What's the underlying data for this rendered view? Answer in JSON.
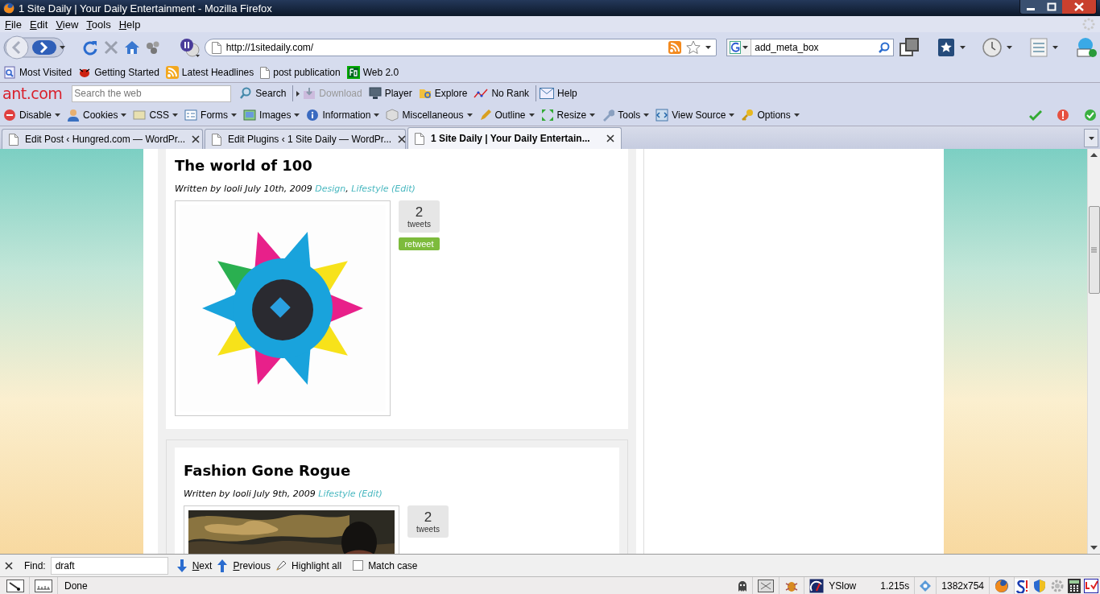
{
  "window": {
    "title": "1 Site Daily | Your Daily Entertainment - Mozilla Firefox"
  },
  "menu": [
    "File",
    "Edit",
    "View",
    "Tools",
    "Help"
  ],
  "address_bar": {
    "value": "http://1sitedaily.com/"
  },
  "search_box": {
    "value": "add_meta_box"
  },
  "bookmarks": [
    {
      "label": "Most Visited",
      "kind": "search"
    },
    {
      "label": "Getting Started",
      "kind": "bug"
    },
    {
      "label": "Latest Headlines",
      "kind": "feed"
    },
    {
      "label": "post publication",
      "kind": "page"
    },
    {
      "label": "Web 2.0",
      "kind": "badge"
    }
  ],
  "ant_toolbar": {
    "logo": "ant.com",
    "search_placeholder": "Search the web",
    "items": [
      {
        "label": "Search",
        "kind": "search",
        "disabled": false
      },
      {
        "label": "Download",
        "kind": "download",
        "disabled": true
      },
      {
        "label": "Player",
        "kind": "player",
        "disabled": false
      },
      {
        "label": "Explore",
        "kind": "explore",
        "disabled": false
      },
      {
        "label": "No Rank",
        "kind": "rank",
        "disabled": false
      },
      {
        "label": "Help",
        "kind": "help",
        "disabled": false
      }
    ]
  },
  "webdev_toolbar": [
    "Disable",
    "Cookies",
    "CSS",
    "Forms",
    "Images",
    "Information",
    "Miscellaneous",
    "Outline",
    "Resize",
    "Tools",
    "View Source",
    "Options"
  ],
  "tabs": [
    {
      "label": "Edit Post ‹ Hungred.com — WordPr...",
      "selected": false
    },
    {
      "label": "Edit Plugins ‹ 1 Site Daily — WordPr...",
      "selected": false
    },
    {
      "label": "1 Site Daily | Your Daily Entertain...",
      "selected": true
    }
  ],
  "posts": [
    {
      "title": "The world of 100",
      "byline": "Written by looli July 10th, 2009",
      "categories": [
        "Design",
        "Lifestyle"
      ],
      "separator": ",",
      "edit": "(Edit)",
      "tweet_count": "2",
      "tweet_label": "tweets",
      "retweet": "retweet",
      "image": {
        "kind": "picture"
      }
    },
    {
      "title": "Fashion Gone Rogue",
      "byline": "Written by looli July 9th, 2009",
      "categories": [
        "Lifestyle"
      ],
      "edit": "(Edit)",
      "tweet_count": "2",
      "tweet_label": "tweets",
      "image": {
        "kind": "picture"
      }
    }
  ],
  "find_bar": {
    "label": "Find:",
    "value": "draft",
    "next": "Next",
    "previous": "Previous",
    "highlight_all": "Highlight all",
    "match_case": {
      "label": "Match case",
      "checked": false
    }
  },
  "status_bar": {
    "status": "Done",
    "yslow": "YSlow",
    "load_time": "1.215s",
    "size": "1382x754"
  }
}
